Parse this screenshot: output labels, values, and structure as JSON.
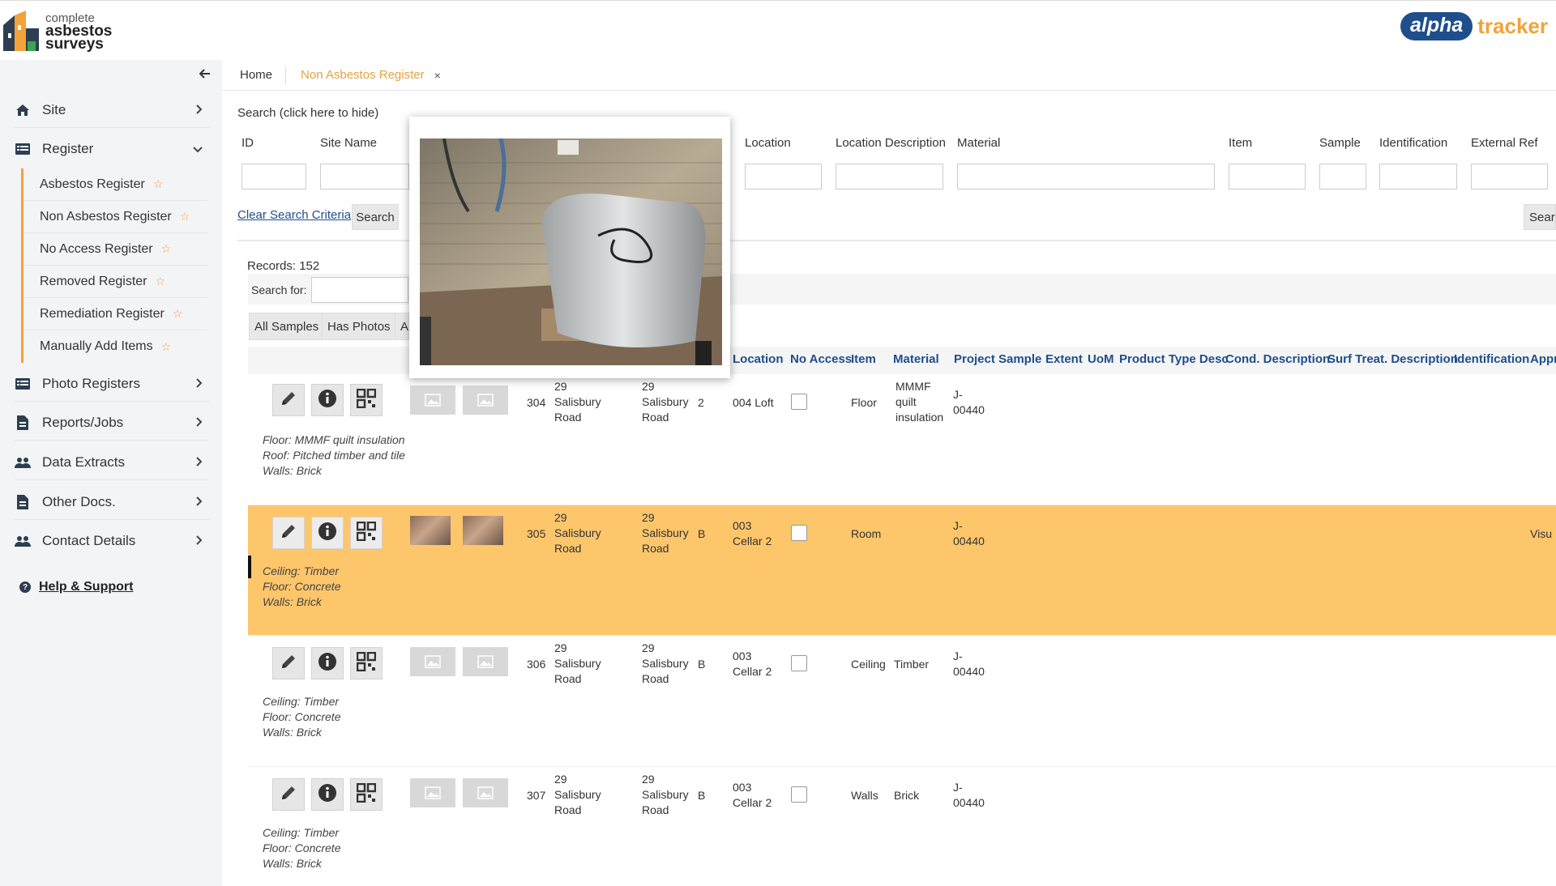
{
  "logo": {
    "line1": "complete",
    "line2": "asbestos",
    "line3": "surveys"
  },
  "brand": {
    "alpha": "alpha",
    "tracker": "tracker"
  },
  "sidebar": {
    "items": [
      {
        "label": "Site",
        "icon": "home-icon"
      },
      {
        "label": "Register",
        "icon": "list-icon",
        "expanded": true
      },
      {
        "label": "Photo Registers",
        "icon": "list-icon"
      },
      {
        "label": "Reports/Jobs",
        "icon": "document-icon"
      },
      {
        "label": "Data Extracts",
        "icon": "users-icon"
      },
      {
        "label": "Other Docs.",
        "icon": "document-icon"
      },
      {
        "label": "Contact Details",
        "icon": "users-icon"
      }
    ],
    "register_sub": [
      "Asbestos Register",
      "Non Asbestos Register",
      "No Access Register",
      "Removed Register",
      "Remediation Register",
      "Manually Add Items"
    ],
    "help": "Help & Support"
  },
  "tabs": {
    "home": "Home",
    "active": "Non Asbestos Register",
    "close": "×"
  },
  "search": {
    "title": "Search (click here to hide)",
    "columns": [
      "ID",
      "Site Name",
      "Location",
      "Location Description",
      "Material",
      "Item",
      "Sample",
      "Identification",
      "External Ref"
    ],
    "clear": "Clear Search Criteria",
    "button": "Search",
    "button_right": "Searc"
  },
  "records": {
    "label": "Records:",
    "count": "152"
  },
  "search_for": "Search for:",
  "filters": [
    "All Samples",
    "Has Photos",
    "Al"
  ],
  "grid": {
    "headers": [
      "Location",
      "No Access",
      "Item",
      "Material",
      "Project",
      "Sample",
      "Extent",
      "UoM",
      "Product Type Desc",
      "Cond. Description",
      "Surf Treat. Description",
      "Identification",
      "Appr"
    ],
    "rows": [
      {
        "id": "304",
        "site": [
          "29",
          "Salisbury",
          "Road"
        ],
        "locname": [
          "29",
          "Salisbury",
          "Road"
        ],
        "floor": "2",
        "location": [
          "004 Loft"
        ],
        "item": "Floor",
        "material": [
          "MMMF",
          "quilt",
          "insulation"
        ],
        "project": [
          "J-",
          "00440"
        ],
        "desc": [
          "Floor: MMMF quilt insulation",
          "Roof: Pitched timber and tile",
          "Walls: Brick"
        ],
        "extra": ""
      },
      {
        "id": "305",
        "site": [
          "29",
          "Salisbury",
          "Road"
        ],
        "locname": [
          "29",
          "Salisbury",
          "Road"
        ],
        "floor": "B",
        "location": [
          "003",
          "Cellar 2"
        ],
        "item": "Room",
        "material": [],
        "project": [
          "J-",
          "00440"
        ],
        "desc": [
          "Ceiling: Timber",
          "Floor: Concrete",
          "Walls: Brick"
        ],
        "extra": "Visu"
      },
      {
        "id": "306",
        "site": [
          "29",
          "Salisbury",
          "Road"
        ],
        "locname": [
          "29",
          "Salisbury",
          "Road"
        ],
        "floor": "B",
        "location": [
          "003",
          "Cellar 2"
        ],
        "item": "Ceiling",
        "material": [
          "Timber"
        ],
        "project": [
          "J-",
          "00440"
        ],
        "desc": [
          "Ceiling: Timber",
          "Floor: Concrete",
          "Walls: Brick"
        ],
        "extra": ""
      },
      {
        "id": "307",
        "site": [
          "29",
          "Salisbury",
          "Road"
        ],
        "locname": [
          "29",
          "Salisbury",
          "Road"
        ],
        "floor": "B",
        "location": [
          "003",
          "Cellar 2"
        ],
        "item": "Walls",
        "material": [
          "Brick"
        ],
        "project": [
          "J-",
          "00440"
        ],
        "desc": [
          "Ceiling: Timber",
          "Floor: Concrete",
          "Walls: Brick"
        ],
        "extra": ""
      }
    ]
  },
  "colors": {
    "accent": "#f4a23a",
    "selected_row": "#fdc66b",
    "header_blue": "#1f4e8c",
    "sidebar_bg": "#f3f4f6"
  }
}
